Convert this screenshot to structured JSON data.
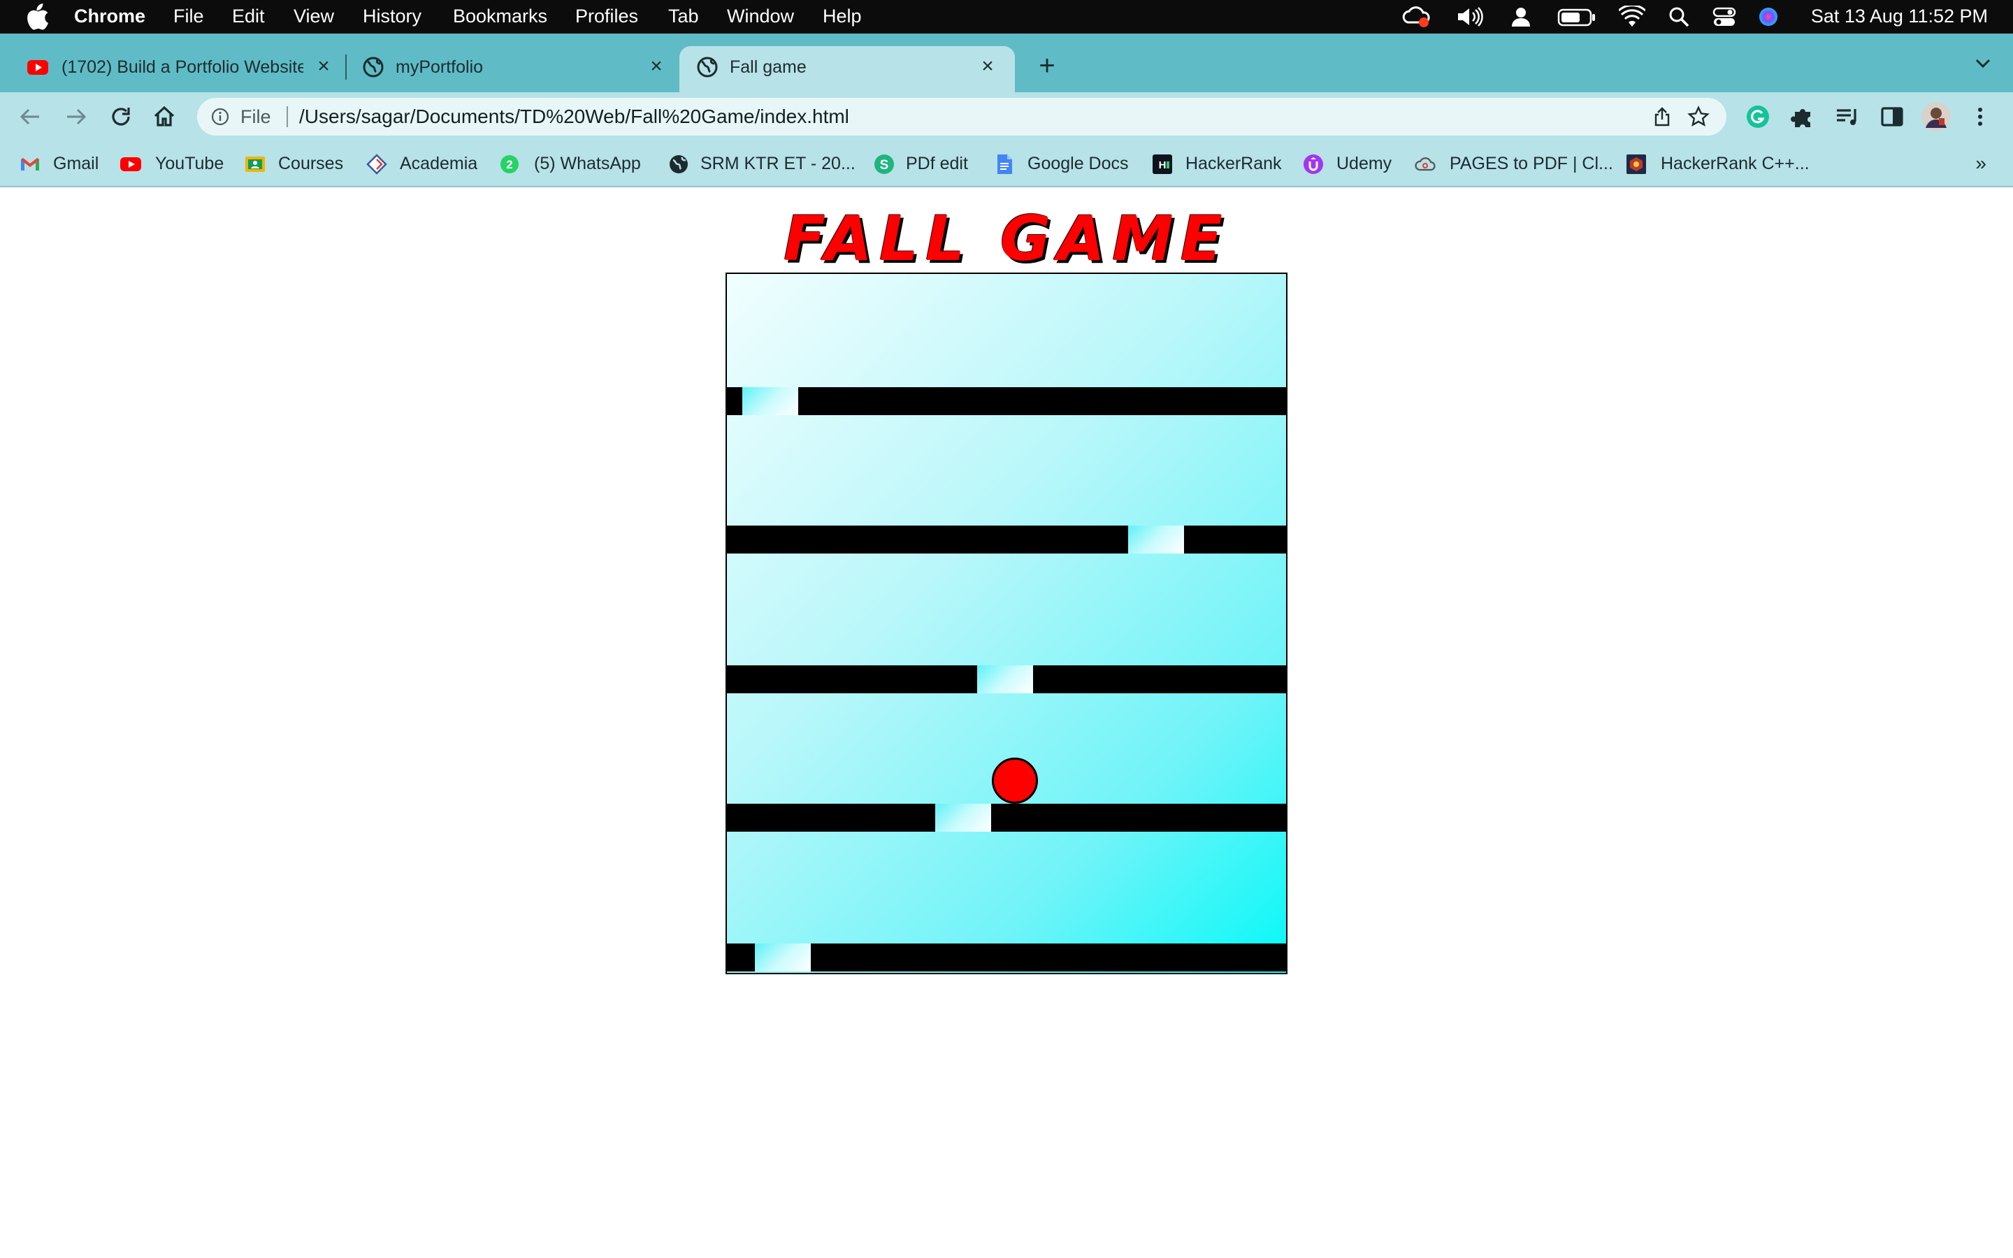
{
  "menubar": {
    "app_name": "Chrome",
    "menus": [
      "File",
      "Edit",
      "View",
      "History",
      "Bookmarks",
      "Profiles",
      "Tab",
      "Window",
      "Help"
    ],
    "clock": "Sat 13 Aug  11:52 PM",
    "status_icons": [
      "creative-cloud-icon",
      "volume-icon",
      "user-icon",
      "battery-icon",
      "wifi-icon",
      "spotlight-icon",
      "control-center-icon",
      "siri-icon"
    ]
  },
  "tabs": [
    {
      "title": "(1702) Build a Portfolio Website",
      "favicon": "youtube-icon",
      "active": false
    },
    {
      "title": "myPortfolio",
      "favicon": "globe-icon",
      "active": false
    },
    {
      "title": "Fall game",
      "favicon": "globe-icon",
      "active": true
    }
  ],
  "toolbar": {
    "scheme": "File",
    "url": "/Users/sagar/Documents/TD%20Web/Fall%20Game/index.html"
  },
  "bookmarks": [
    {
      "label": "Gmail",
      "icon": "gmail-icon"
    },
    {
      "label": "YouTube",
      "icon": "youtube-icon"
    },
    {
      "label": "Courses",
      "icon": "classroom-icon"
    },
    {
      "label": "Academia",
      "icon": "academia-icon"
    },
    {
      "label": "(5) WhatsApp",
      "icon": "whatsapp-icon"
    },
    {
      "label": "SRM KTR ET - 20...",
      "icon": "globe-icon"
    },
    {
      "label": "PDf edit",
      "icon": "sejda-icon"
    },
    {
      "label": "Google Docs",
      "icon": "docs-icon"
    },
    {
      "label": "HackerRank",
      "icon": "hackerrank-icon"
    },
    {
      "label": "Udemy",
      "icon": "udemy-icon"
    },
    {
      "label": "PAGES to PDF | Cl...",
      "icon": "cloudconvert-icon"
    },
    {
      "label": "HackerRank C++...",
      "icon": "hackerrank-cpp-icon"
    }
  ],
  "bookmarks_overflow": "»",
  "game": {
    "title": "FALL GAME",
    "colors": {
      "ball": "#ff0000",
      "bar": "#000000",
      "bg_light": "#f1fefe",
      "bg_dark": "#06f8f8"
    }
  }
}
